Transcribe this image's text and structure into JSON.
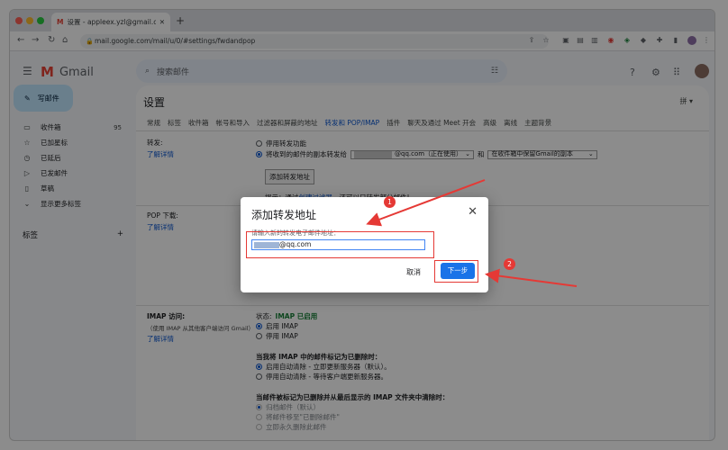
{
  "browser": {
    "tab_title": "设置 - appleex.yzl@gmail.com",
    "new_tab_icon": "plus-icon",
    "url": "mail.google.com/mail/u/0/#settings/fwdandpop"
  },
  "gmail": {
    "logo_text": "Gmail",
    "search_placeholder": "搜索邮件"
  },
  "sidebar": {
    "compose_label": "写邮件",
    "items": [
      {
        "icon": "inbox-icon",
        "label": "收件箱",
        "count": "95"
      },
      {
        "icon": "star-icon",
        "label": "已加星标",
        "count": ""
      },
      {
        "icon": "clock-icon",
        "label": "已延后",
        "count": ""
      },
      {
        "icon": "send-icon",
        "label": "已发邮件",
        "count": ""
      },
      {
        "icon": "draft-icon",
        "label": "草稿",
        "count": ""
      },
      {
        "icon": "chevron-down-icon",
        "label": "显示更多标签",
        "count": ""
      }
    ],
    "labels_heading": "标签",
    "add_label": "+"
  },
  "settings": {
    "title": "设置",
    "lang_button": "拼 ▾",
    "tabs": [
      "常规",
      "标签",
      "收件箱",
      "帐号和导入",
      "过滤器和屏蔽的地址",
      "转发和 POP/IMAP",
      "插件",
      "聊天及通过 Meet 开会",
      "高级",
      "离线",
      "主题背景"
    ],
    "forwarding": {
      "label": "转发:",
      "learn_more": "了解详情",
      "opt_disable": "停用转发功能",
      "opt_forward_prefix": "将收到的邮件的副本转发给",
      "forward_address": "@qq.com（正在使用）",
      "and": "和",
      "keep_option": "在收件箱中保留Gmail的副本",
      "add_button": "添加转发地址",
      "hint_prefix": "提示：通过",
      "hint_link": "创建过滤器",
      "hint_suffix": "，还可以只转发部分邮件!"
    },
    "pop": {
      "label": "POP 下载:",
      "learn_more": "了解详情"
    },
    "imap": {
      "label": "IMAP 访问:",
      "sub": "（使用 IMAP 从其他客户端访问 Gmail）",
      "learn_more": "了解详情",
      "status_prefix": "状态:",
      "status_value": "IMAP 已启用",
      "opt_enable": "启用 IMAP",
      "opt_disable": "停用 IMAP",
      "deleted_heading": "当我将 IMAP 中的邮件标记为已删除时：",
      "auto_on": "启用自动清除 - 立即更新服务器（默认）。",
      "auto_off": "停用自动清除 - 等待客户端更新服务器。",
      "expunge_heading": "当邮件被标记为已删除并从最后显示的 IMAP 文件夹中清除时：",
      "archive": "归档邮件（默认）",
      "trash": "将邮件移至\"已删除邮件\"",
      "delete_forever": "立即永久删除此邮件"
    }
  },
  "dialog": {
    "title": "添加转发地址",
    "hint": "请输入新的转发电子邮件地址：",
    "input_value": "@qq.com",
    "cancel": "取消",
    "next": "下一步"
  },
  "annotations": {
    "badge1": "1",
    "badge2": "2",
    "color": "#e53935"
  }
}
